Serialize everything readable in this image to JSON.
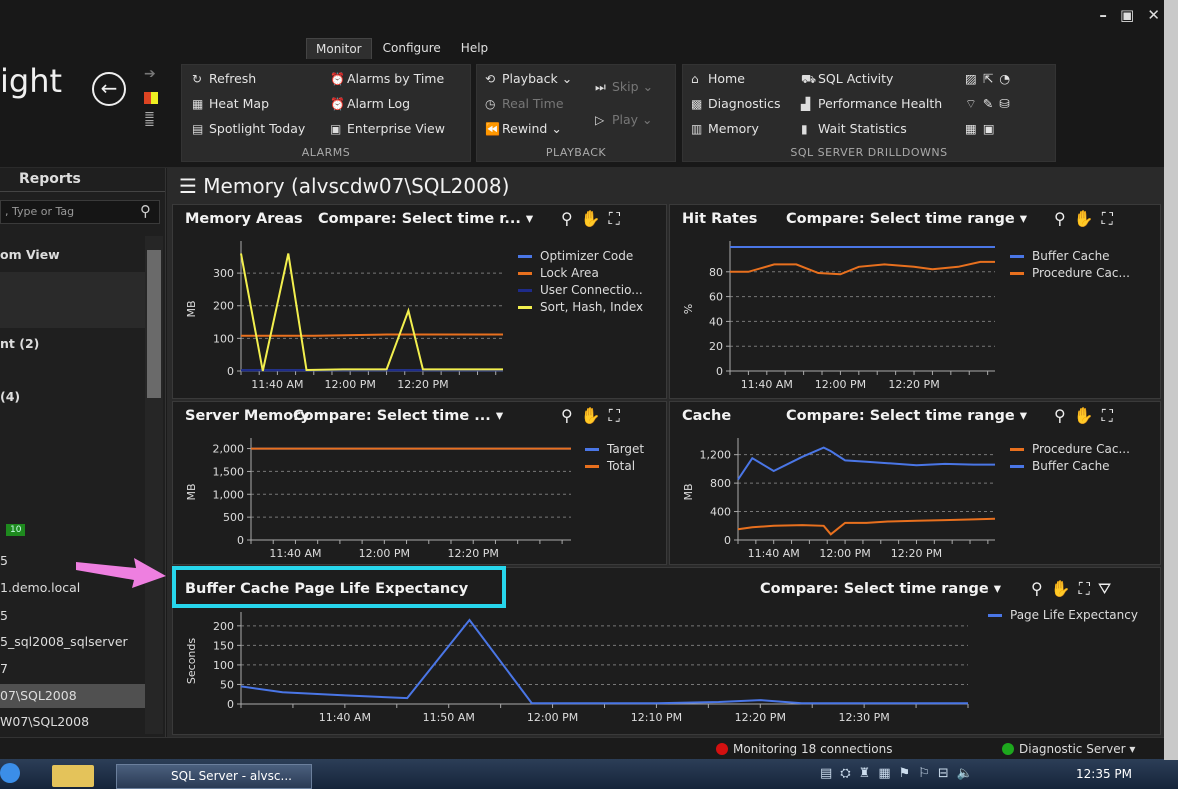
{
  "window": {
    "controls": "– ▣ ✕",
    "title": "ight"
  },
  "ribbon": {
    "tabs": [
      "Monitor",
      "Configure",
      "Help"
    ],
    "alarms": {
      "label": "ALARMS",
      "items": [
        "Refresh",
        "Alarms by Time",
        "Heat Map",
        "Alarm Log",
        "Spotlight Today",
        "Enterprise View"
      ]
    },
    "playback": {
      "label": "PLAYBACK",
      "items": [
        "Playback",
        "Skip",
        "Real Time",
        "Play",
        "Rewind"
      ]
    },
    "drilldowns": {
      "label": "SQL SERVER DRILLDOWNS",
      "items": [
        "Home",
        "SQL Activity",
        "Diagnostics",
        "Performance Health",
        "Memory",
        "Wait Statistics"
      ]
    }
  },
  "sidebar": {
    "tab": "Reports",
    "search_placeholder": ", Type or Tag",
    "items": [
      "om View",
      "nt (2)",
      "(4)",
      "5",
      "1.demo.local",
      "5",
      "5_sql2008_sqlserver",
      "7",
      "07\\SQL2008",
      "W07\\SQL2008"
    ],
    "badge": "10"
  },
  "main": {
    "title": "Memory (alvscdw07\\SQL2008)",
    "compare_label": "Compare: Select time range",
    "compare_short": "Compare: Select time r...",
    "compare_short2": "Compare: Select time ...",
    "panels": {
      "memory_areas": {
        "title": "Memory Areas"
      },
      "hit_rates": {
        "title": "Hit Rates"
      },
      "server_memory": {
        "title": "Server Memory"
      },
      "cache": {
        "title": "Cache"
      },
      "ple": {
        "title": "Buffer Cache Page Life Expectancy"
      }
    }
  },
  "status": {
    "monitoring": "Monitoring 18 connections",
    "diagnostic": "Diagnostic Server"
  },
  "taskbar": {
    "app": "SQL Server - alvsc...",
    "time": "12:35 PM"
  },
  "colors": {
    "blue": "#4a76e6",
    "orange": "#e8701e",
    "navy": "#1e2b8a",
    "yellow": "#f2ef4e",
    "highlight": "#27d6ec",
    "arrow": "#ee7fe0"
  },
  "chart_data": [
    {
      "type": "line",
      "title": "Memory Areas",
      "ylabel": "MB",
      "ylim": [
        0,
        380
      ],
      "yticks": [
        0,
        100,
        200,
        300
      ],
      "xticks": [
        "11:40 AM",
        "12:00 PM",
        "12:20 PM"
      ],
      "xtick_pos": [
        10,
        30,
        50
      ],
      "xlim": [
        0,
        72
      ],
      "series": [
        {
          "name": "Optimizer Code",
          "color": "#4a76e6",
          "x": [
            0,
            72
          ],
          "y": [
            2,
            2
          ]
        },
        {
          "name": "Lock Area",
          "color": "#e8701e",
          "x": [
            0,
            20,
            40,
            72
          ],
          "y": [
            108,
            108,
            112,
            112
          ]
        },
        {
          "name": "User Connectio...",
          "color": "#1e2b8a",
          "x": [
            0,
            72
          ],
          "y": [
            2,
            2
          ]
        },
        {
          "name": "Sort, Hash, Index",
          "color": "#f2ef4e",
          "x": [
            0,
            6,
            13,
            18,
            28,
            40,
            46,
            50,
            60,
            72
          ],
          "y": [
            360,
            0,
            360,
            3,
            5,
            5,
            185,
            5,
            5,
            5
          ]
        }
      ]
    },
    {
      "type": "line",
      "title": "Hit Rates",
      "ylabel": "%",
      "ylim": [
        0,
        100
      ],
      "yticks": [
        0,
        20,
        40,
        60,
        80
      ],
      "xticks": [
        "11:40 AM",
        "12:00 PM",
        "12:20 PM"
      ],
      "xtick_pos": [
        10,
        30,
        50
      ],
      "xlim": [
        0,
        72
      ],
      "series": [
        {
          "name": "Buffer Cache",
          "color": "#4a76e6",
          "x": [
            0,
            72
          ],
          "y": [
            100,
            100
          ]
        },
        {
          "name": "Procedure Cac...",
          "color": "#e8701e",
          "x": [
            0,
            5,
            12,
            18,
            24,
            30,
            35,
            42,
            50,
            55,
            62,
            68,
            72
          ],
          "y": [
            80,
            80,
            86,
            86,
            79,
            78,
            84,
            86,
            84,
            82,
            84,
            88,
            88
          ]
        }
      ]
    },
    {
      "type": "line",
      "title": "Server Memory",
      "ylabel": "MB",
      "ylim": [
        0,
        2100
      ],
      "yticks": [
        0,
        500,
        1000,
        1500,
        2000
      ],
      "ytick_labels": [
        "0",
        "500",
        "1,000",
        "1,500",
        "2,000"
      ],
      "xticks": [
        "11:40 AM",
        "12:00 PM",
        "12:20 PM"
      ],
      "xtick_pos": [
        10,
        30,
        50
      ],
      "xlim": [
        0,
        72
      ],
      "series": [
        {
          "name": "Target",
          "color": "#4a76e6",
          "x": [
            0,
            72
          ],
          "y": [
            2000,
            2000
          ]
        },
        {
          "name": "Total",
          "color": "#e8701e",
          "x": [
            0,
            72
          ],
          "y": [
            2000,
            2000
          ]
        }
      ]
    },
    {
      "type": "line",
      "title": "Cache",
      "ylabel": "MB",
      "ylim": [
        0,
        1350
      ],
      "yticks": [
        0,
        400,
        800,
        1200
      ],
      "ytick_labels": [
        "0",
        "400",
        "800",
        "1,200"
      ],
      "xticks": [
        "11:40 AM",
        "12:00 PM",
        "12:20 PM"
      ],
      "xtick_pos": [
        10,
        30,
        50
      ],
      "xlim": [
        0,
        72
      ],
      "series": [
        {
          "name": "Procedure Cac...",
          "color": "#e8701e",
          "x": [
            0,
            4,
            10,
            18,
            24,
            26,
            30,
            36,
            42,
            50,
            58,
            66,
            72
          ],
          "y": [
            150,
            180,
            200,
            210,
            200,
            80,
            240,
            240,
            260,
            270,
            280,
            290,
            300
          ]
        },
        {
          "name": "Buffer Cache",
          "color": "#4a76e6",
          "x": [
            0,
            4,
            10,
            18,
            24,
            26,
            30,
            36,
            42,
            50,
            58,
            66,
            72
          ],
          "y": [
            850,
            1150,
            970,
            1170,
            1300,
            1250,
            1120,
            1100,
            1080,
            1050,
            1070,
            1060,
            1060
          ]
        }
      ]
    },
    {
      "type": "line",
      "title": "Buffer Cache Page Life Expectancy",
      "ylabel": "Seconds",
      "ylim": [
        0,
        220
      ],
      "yticks": [
        0,
        50,
        100,
        150,
        200
      ],
      "xticks": [
        "11:40 AM",
        "11:50 AM",
        "12:00 PM",
        "12:10 PM",
        "12:20 PM",
        "12:30 PM"
      ],
      "xtick_pos": [
        10,
        20,
        30,
        40,
        50,
        60
      ],
      "xlim": [
        0,
        70
      ],
      "series": [
        {
          "name": "Page Life Expectancy",
          "color": "#4a76e6",
          "x": [
            0,
            4,
            10,
            16,
            22,
            28,
            34,
            40,
            46,
            50,
            54,
            60,
            70
          ],
          "y": [
            45,
            30,
            22,
            15,
            215,
            2,
            2,
            2,
            5,
            10,
            2,
            2,
            2
          ]
        }
      ]
    }
  ]
}
